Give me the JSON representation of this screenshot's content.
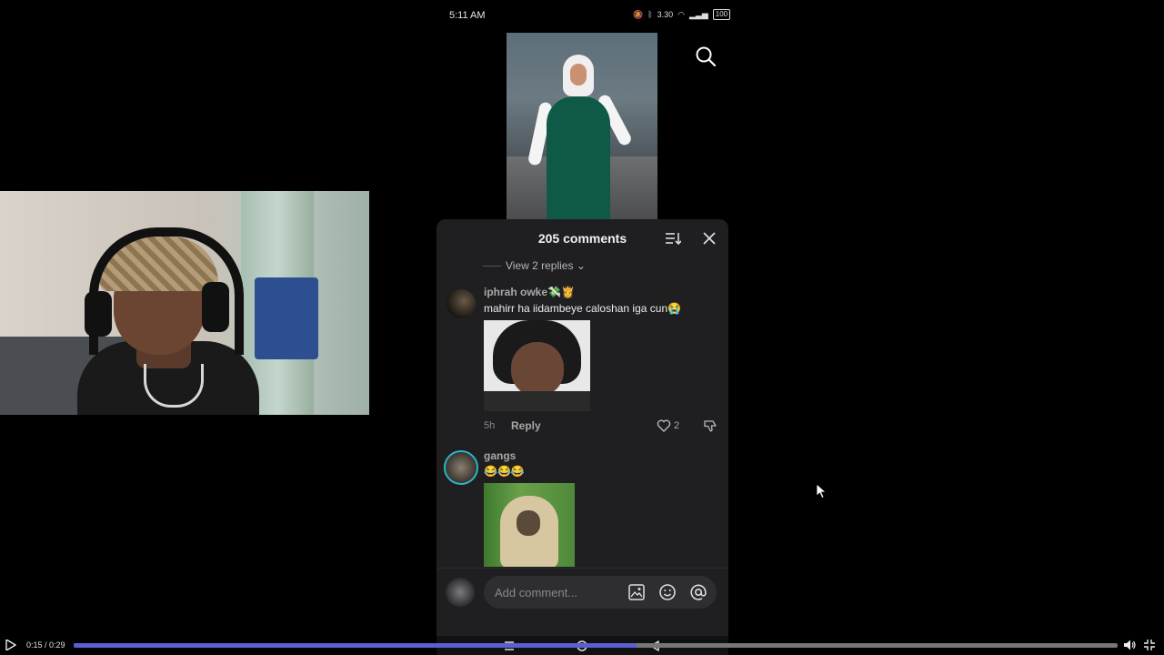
{
  "status_bar": {
    "time": "5:11 AM",
    "network": "3.30",
    "battery": "100"
  },
  "comments": {
    "title": "205 comments",
    "view_replies": "View 2 replies",
    "items": [
      {
        "username": "iphrah owke💸👸",
        "text": "mahirr ha iidambeye caloshan iga cun😭",
        "age": "5h",
        "reply": "Reply",
        "likes": "2"
      },
      {
        "username": "gangs",
        "text": "😂😂😂"
      }
    ],
    "input_placeholder": "Add comment..."
  },
  "player": {
    "time": "0:15 / 0:29",
    "progress": 0.539
  },
  "colors": {
    "accent": "#5b5fd6",
    "panel": "#1f1f21",
    "story_ring": "#2bb6c8"
  }
}
